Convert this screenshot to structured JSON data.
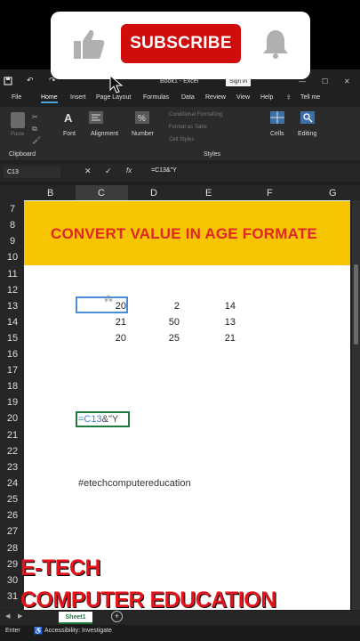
{
  "overlay": {
    "subscribe_label": "SUBSCRIBE",
    "brand_red": "#d00d0d"
  },
  "titlebar": {
    "title": "Book1 - Excel",
    "signin": "Sign in"
  },
  "tabs": [
    "File",
    "Home",
    "Insert",
    "Page Layout",
    "Formulas",
    "Data",
    "Review",
    "View",
    "Help",
    "Tell me"
  ],
  "ribbon": {
    "groups": {
      "clipboard": "Clipboard",
      "font": "Font",
      "alignment": "Alignment",
      "number": "Number",
      "styles": "Styles",
      "cells": "Cells",
      "editing": "Editing"
    },
    "style_items": [
      "Conditional Formatting",
      "Format as Table",
      "Cell Styles"
    ],
    "paste": "Paste"
  },
  "formula_bar": {
    "name_box": "C13",
    "formula": "=C13&\"Y"
  },
  "columns": [
    "B",
    "C",
    "D",
    "E",
    "F",
    "G"
  ],
  "rows": [
    "7",
    "8",
    "9",
    "10",
    "11",
    "12",
    "13",
    "14",
    "15",
    "16",
    "17",
    "18",
    "19",
    "20",
    "21",
    "22",
    "23",
    "24",
    "25",
    "26",
    "27",
    "28",
    "29",
    "30",
    "31"
  ],
  "sheet": {
    "banner": "CONVERT VALUE IN  AGE FORMATE",
    "data": [
      [
        "20",
        "2",
        "14"
      ],
      [
        "21",
        "50",
        "13"
      ],
      [
        "20",
        "25",
        "21"
      ]
    ],
    "edit_ref": "=C13",
    "edit_rest": "&\"Y",
    "hashtag": "#etechcomputereducation"
  },
  "sheet_tab": "Sheet1",
  "status": {
    "mode": "Enter",
    "accessibility": "Accessibility: Investigate"
  },
  "watermark": {
    "line1": "E-TECH",
    "line2": "COMPUTER EDUCATION"
  }
}
